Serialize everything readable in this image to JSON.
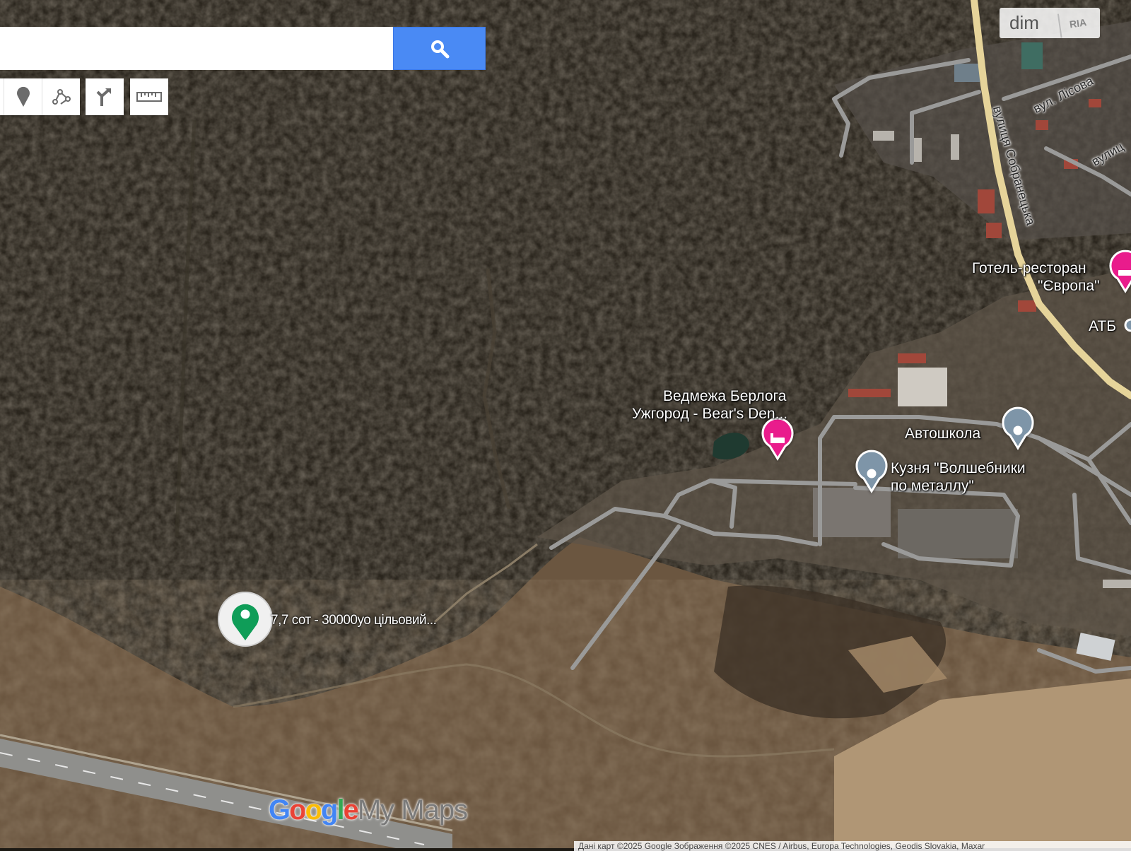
{
  "search": {
    "value": "",
    "placeholder": ""
  },
  "toolbar": {
    "tools": [
      {
        "icon": "marker-icon"
      },
      {
        "icon": "draw-line-icon"
      },
      {
        "icon": "directions-icon"
      },
      {
        "icon": "ruler-icon"
      }
    ]
  },
  "watermark": {
    "text": "dim",
    "sub": "RIA"
  },
  "places": {
    "bears_den_line1": "Ведмежа Берлога",
    "bears_den_line2": "Ужгород - Bear's Den...",
    "driving_school": "Автошкола",
    "forge_line1": "Кузня \"Волшебники",
    "forge_line2": "по металлу\"",
    "hotel_line1": "Готель-ресторан",
    "hotel_line2": "\"Європа\"",
    "atb": "АТБ"
  },
  "roads": {
    "sobranetska": "вулиця Собранецька",
    "lisova": "вул. Лісова",
    "partial": "вулиц"
  },
  "user_marker": {
    "label": "7,7 сот - 30000уо цільовий...",
    "color": "#0f9d58"
  },
  "logo": {
    "google": "Google",
    "mymaps": "My Maps"
  },
  "attribution": "Дані карт ©2025 Google Зображення ©2025 CNES / Airbus, Europa Technologies, Geodis Slovakia, Maxar",
  "colors": {
    "search_button": "#4a8af4",
    "hotel_pin": "#e91e8c",
    "poi_pin": "#7e95a8",
    "main_road": "#e6d49a"
  }
}
